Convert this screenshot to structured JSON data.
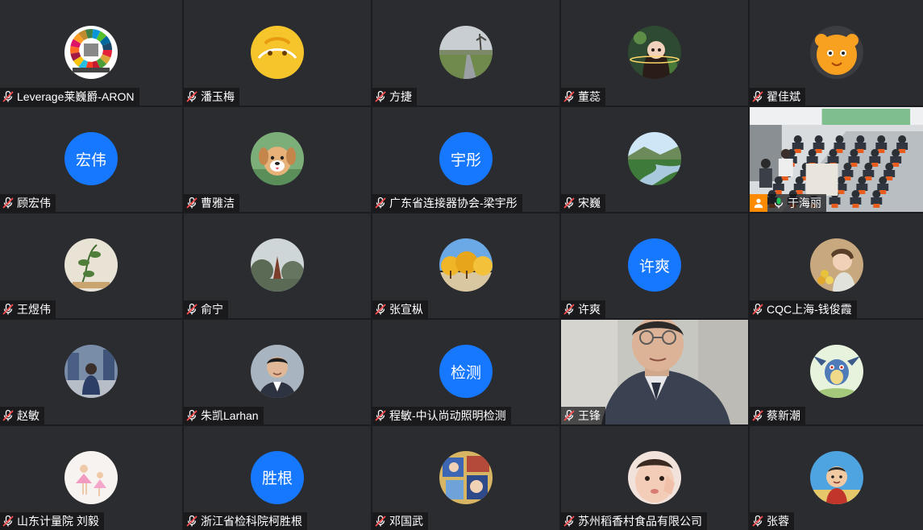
{
  "colors": {
    "background": "#1b1c1f",
    "tile": "#2b2c2f",
    "text_avatar": "#1677ff",
    "speaking": "#21c35b",
    "muted_mic": "#ff4d4f",
    "host_badge": "#ff8a00"
  },
  "participants": [
    {
      "name": "Leverage莱巍爵-ARON",
      "avatar_type": "image",
      "avatar": "leverage-logo",
      "mic": "muted"
    },
    {
      "name": "潘玉梅",
      "avatar_type": "image",
      "avatar": "yellow-cartoon",
      "mic": "muted"
    },
    {
      "name": "方捷",
      "avatar_type": "image",
      "avatar": "landscape-road",
      "mic": "muted"
    },
    {
      "name": "董蕊",
      "avatar_type": "image",
      "avatar": "anime-girl",
      "mic": "muted"
    },
    {
      "name": "翟佳斌",
      "avatar_type": "image",
      "avatar": "orange-cartoon",
      "mic": "muted"
    },
    {
      "name": "顾宏伟",
      "avatar_type": "text",
      "avatar_text": "宏伟",
      "mic": "muted"
    },
    {
      "name": "曹雅洁",
      "avatar_type": "image",
      "avatar": "puppy",
      "mic": "muted"
    },
    {
      "name": "广东省连接器协会-梁宇彤",
      "avatar_type": "text",
      "avatar_text": "宇彤",
      "mic": "muted"
    },
    {
      "name": "宋巍",
      "avatar_type": "image",
      "avatar": "river-valley",
      "mic": "muted"
    },
    {
      "name": "于海丽",
      "avatar_type": "video",
      "avatar": "conference-room",
      "mic": "active",
      "host": true,
      "speaking": true
    },
    {
      "name": "王煜伟",
      "avatar_type": "image",
      "avatar": "plant-drawing",
      "mic": "muted"
    },
    {
      "name": "俞宁",
      "avatar_type": "image",
      "avatar": "pagoda-sky",
      "mic": "muted"
    },
    {
      "name": "张宣枞",
      "avatar_type": "image",
      "avatar": "golden-trees",
      "mic": "muted"
    },
    {
      "name": "许爽",
      "avatar_type": "text",
      "avatar_text": "许爽",
      "mic": "muted"
    },
    {
      "name": "CQC上海-钱俊霞",
      "avatar_type": "image",
      "avatar": "woman-flowers",
      "mic": "muted"
    },
    {
      "name": "赵敏",
      "avatar_type": "image",
      "avatar": "city-child",
      "mic": "muted"
    },
    {
      "name": "朱凯Larhan",
      "avatar_type": "image",
      "avatar": "man-portrait",
      "mic": "muted"
    },
    {
      "name": "程敏-中认尚动照明检测",
      "avatar_type": "text",
      "avatar_text": "检测",
      "mic": "muted"
    },
    {
      "name": "王锋",
      "avatar_type": "video",
      "avatar": "man-webcam",
      "mic": "muted"
    },
    {
      "name": "蔡新潮",
      "avatar_type": "image",
      "avatar": "dragon-cartoon",
      "mic": "muted"
    },
    {
      "name": "山东计量院 刘毅",
      "avatar_type": "image",
      "avatar": "dancers-pink",
      "mic": "muted"
    },
    {
      "name": "浙江省检科院柯胜根",
      "avatar_type": "text",
      "avatar_text": "胜根",
      "mic": "muted"
    },
    {
      "name": "邓国武",
      "avatar_type": "image",
      "avatar": "anime-collage",
      "mic": "muted"
    },
    {
      "name": "苏州稻香村食品有限公司",
      "avatar_type": "image",
      "avatar": "child-face",
      "mic": "muted"
    },
    {
      "name": "张蓉",
      "avatar_type": "image",
      "avatar": "cartoon-boy",
      "mic": "muted"
    }
  ]
}
